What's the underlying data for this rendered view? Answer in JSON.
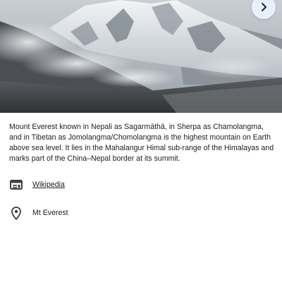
{
  "hero": {
    "image": "mountain-photo",
    "next_icon": "chevron-right-icon",
    "accent_color": "#e8f0fe"
  },
  "description": "Mount Everest known in Nepali as Sagarmāthā, in Sherpa as Chamolangma, and in Tibetan as Jomolangma/Chomolangma is the highest mountain on Earth above sea level. It lies in the Mahalangur Himal sub-range of the Himalayas and marks part of the China–Nepal border at its summit.",
  "links": {
    "source_icon": "article-icon",
    "source_label": "Wikipedia",
    "link_color": "#1a0dab"
  },
  "place": {
    "icon": "location-pin-icon",
    "label": "Mt Everest"
  }
}
